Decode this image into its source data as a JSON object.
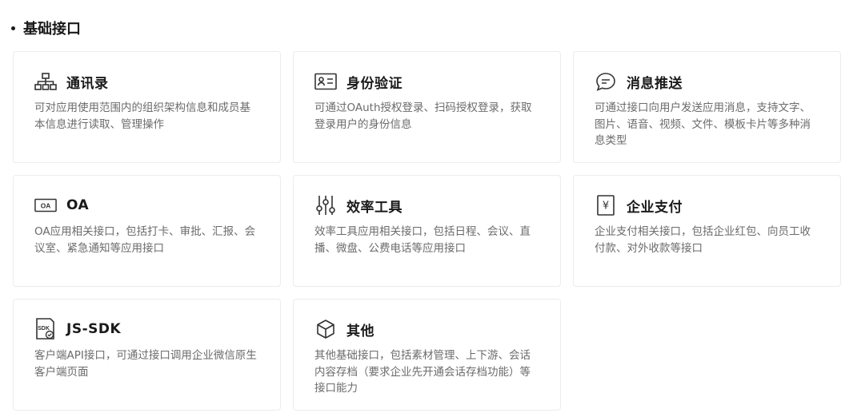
{
  "section": {
    "title": "基础接口"
  },
  "cards": [
    {
      "icon": "org-chart-icon",
      "title": "通讯录",
      "desc": "可对应用使用范围内的组织架构信息和成员基本信息进行读取、管理操作"
    },
    {
      "icon": "id-card-icon",
      "title": "身份验证",
      "desc": "可通过OAuth授权登录、扫码授权登录，获取登录用户的身份信息"
    },
    {
      "icon": "chat-bubble-icon",
      "title": "消息推送",
      "desc": "可通过接口向用户发送应用消息，支持文字、图片、语音、视频、文件、模板卡片等多种消息类型"
    },
    {
      "icon": "oa-icon",
      "icon_text": "OA",
      "title": "OA",
      "desc": "OA应用相关接口，包括打卡、审批、汇报、会议室、紧急通知等应用接口"
    },
    {
      "icon": "sliders-icon",
      "title": "效率工具",
      "desc": "效率工具应用相关接口，包括日程、会议、直播、微盘、公费电话等应用接口"
    },
    {
      "icon": "yen-icon",
      "icon_text": "¥",
      "title": "企业支付",
      "desc": "企业支付相关接口，包括企业红包、向员工收付款、对外收款等接口"
    },
    {
      "icon": "sdk-icon",
      "icon_text": "SDK",
      "title": "JS-SDK",
      "desc": "客户端API接口，可通过接口调用企业微信原生客户端页面"
    },
    {
      "icon": "cube-icon",
      "title": "其他",
      "desc": "其他基础接口，包括素材管理、上下游、会话内容存档（要求企业先开通会话存档功能）等接口能力"
    }
  ]
}
